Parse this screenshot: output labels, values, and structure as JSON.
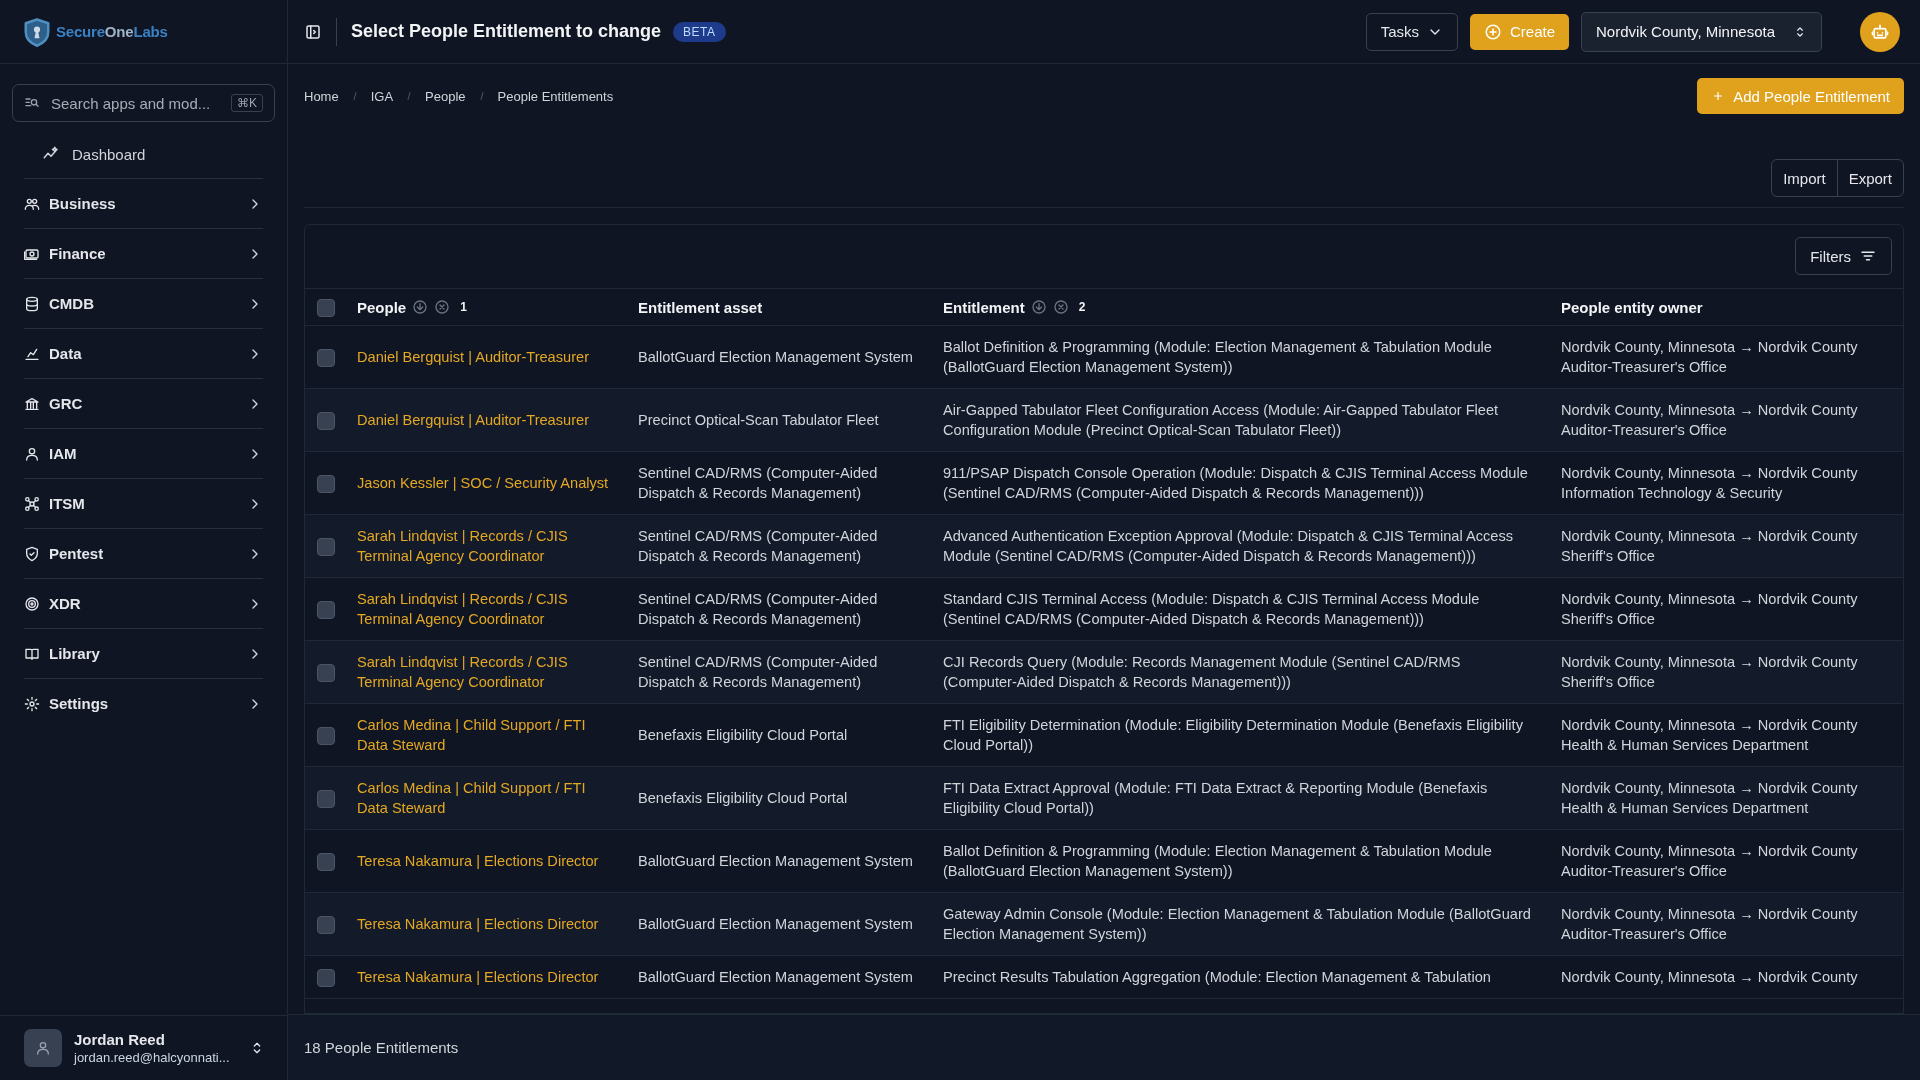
{
  "brand": [
    "Secure",
    "One",
    "Labs"
  ],
  "sidebar": {
    "search": {
      "placeholder": "Search apps and mod...",
      "shortcut": "⌘K"
    },
    "items": [
      {
        "label": "Dashboard",
        "kind": "link"
      },
      {
        "label": "Business",
        "kind": "group"
      },
      {
        "label": "Finance",
        "kind": "group"
      },
      {
        "label": "CMDB",
        "kind": "group"
      },
      {
        "label": "Data",
        "kind": "group"
      },
      {
        "label": "GRC",
        "kind": "group"
      },
      {
        "label": "IAM",
        "kind": "group"
      },
      {
        "label": "ITSM",
        "kind": "group"
      },
      {
        "label": "Pentest",
        "kind": "group"
      },
      {
        "label": "XDR",
        "kind": "group"
      },
      {
        "label": "Library",
        "kind": "group"
      },
      {
        "label": "Settings",
        "kind": "group"
      }
    ],
    "user": {
      "name": "Jordan Reed",
      "email": "jordan.reed@halcyonnati..."
    }
  },
  "topbar": {
    "title": "Select People Entitlement to change",
    "badge": "BETA",
    "tasks": "Tasks",
    "create": "Create",
    "organization": "Nordvik County, Minnesota"
  },
  "breadcrumbs": [
    "Home",
    "IGA",
    "People",
    "People Entitlements"
  ],
  "add_button": "Add People Entitlement",
  "import_button": "Import",
  "export_button": "Export",
  "filters_button": "Filters",
  "table": {
    "select_all": {
      "checked": false
    },
    "columns": [
      {
        "label": "People",
        "sort_rank": "1"
      },
      {
        "label": "Entitlement asset"
      },
      {
        "label": "Entitlement",
        "sort_rank": "2"
      },
      {
        "label": "People entity owner"
      }
    ],
    "rows": [
      {
        "checked": false,
        "person": "Daniel Bergquist | Auditor-Treasurer",
        "asset": "BallotGuard Election Management System",
        "entitlement": "Ballot Definition & Programming (Module: Election Management & Tabulation Module (BallotGuard Election Management System))",
        "owner": "Nordvik County, Minnesota → Nordvik County Auditor-Treasurer's Office"
      },
      {
        "checked": false,
        "person": "Daniel Bergquist | Auditor-Treasurer",
        "asset": "Precinct Optical-Scan Tabulator Fleet",
        "entitlement": "Air-Gapped Tabulator Fleet Configuration Access (Module: Air-Gapped Tabulator Fleet Configuration Module (Precinct Optical-Scan Tabulator Fleet))",
        "owner": "Nordvik County, Minnesota → Nordvik County Auditor-Treasurer's Office"
      },
      {
        "checked": false,
        "person": "Jason Kessler | SOC / Security Analyst",
        "asset": "Sentinel CAD/RMS (Computer-Aided Dispatch & Records Management)",
        "entitlement": "911/PSAP Dispatch Console Operation (Module: Dispatch & CJIS Terminal Access Module (Sentinel CAD/RMS (Computer-Aided Dispatch & Records Management)))",
        "owner": "Nordvik County, Minnesota → Nordvik County Information Technology & Security"
      },
      {
        "checked": false,
        "person": "Sarah Lindqvist | Records / CJIS Terminal Agency Coordinator",
        "asset": "Sentinel CAD/RMS (Computer-Aided Dispatch & Records Management)",
        "entitlement": "Advanced Authentication Exception Approval (Module: Dispatch & CJIS Terminal Access Module (Sentinel CAD/RMS (Computer-Aided Dispatch & Records Management)))",
        "owner": "Nordvik County, Minnesota → Nordvik County Sheriff's Office"
      },
      {
        "checked": false,
        "person": "Sarah Lindqvist | Records / CJIS Terminal Agency Coordinator",
        "asset": "Sentinel CAD/RMS (Computer-Aided Dispatch & Records Management)",
        "entitlement": "Standard CJIS Terminal Access (Module: Dispatch & CJIS Terminal Access Module (Sentinel CAD/RMS (Computer-Aided Dispatch & Records Management)))",
        "owner": "Nordvik County, Minnesota → Nordvik County Sheriff's Office"
      },
      {
        "checked": false,
        "person": "Sarah Lindqvist | Records / CJIS Terminal Agency Coordinator",
        "asset": "Sentinel CAD/RMS (Computer-Aided Dispatch & Records Management)",
        "entitlement": "CJI Records Query (Module: Records Management Module (Sentinel CAD/RMS (Computer-Aided Dispatch & Records Management)))",
        "owner": "Nordvik County, Minnesota → Nordvik County Sheriff's Office"
      },
      {
        "checked": false,
        "person": "Carlos Medina | Child Support / FTI Data Steward",
        "asset": "Benefaxis Eligibility Cloud Portal",
        "entitlement": "FTI Eligibility Determination (Module: Eligibility Determination Module (Benefaxis Eligibility Cloud Portal))",
        "owner": "Nordvik County, Minnesota → Nordvik County Health & Human Services Department"
      },
      {
        "checked": false,
        "person": "Carlos Medina | Child Support / FTI Data Steward",
        "asset": "Benefaxis Eligibility Cloud Portal",
        "entitlement": "FTI Data Extract Approval (Module: FTI Data Extract & Reporting Module (Benefaxis Eligibility Cloud Portal))",
        "owner": "Nordvik County, Minnesota → Nordvik County Health & Human Services Department"
      },
      {
        "checked": false,
        "person": "Teresa Nakamura | Elections Director",
        "asset": "BallotGuard Election Management System",
        "entitlement": "Ballot Definition & Programming (Module: Election Management & Tabulation Module (BallotGuard Election Management System))",
        "owner": "Nordvik County, Minnesota → Nordvik County Auditor-Treasurer's Office"
      },
      {
        "checked": false,
        "person": "Teresa Nakamura | Elections Director",
        "asset": "BallotGuard Election Management System",
        "entitlement": "Gateway Admin Console (Module: Election Management & Tabulation Module (BallotGuard Election Management System))",
        "owner": "Nordvik County, Minnesota → Nordvik County Auditor-Treasurer's Office"
      },
      {
        "checked": false,
        "person": "Teresa Nakamura | Elections Director",
        "asset": "BallotGuard Election Management System",
        "entitlement": "Precinct Results Tabulation Aggregation (Module: Election Management & Tabulation",
        "owner": "Nordvik County, Minnesota → Nordvik County"
      }
    ]
  },
  "footer": {
    "count": "18 People Entitlements"
  }
}
